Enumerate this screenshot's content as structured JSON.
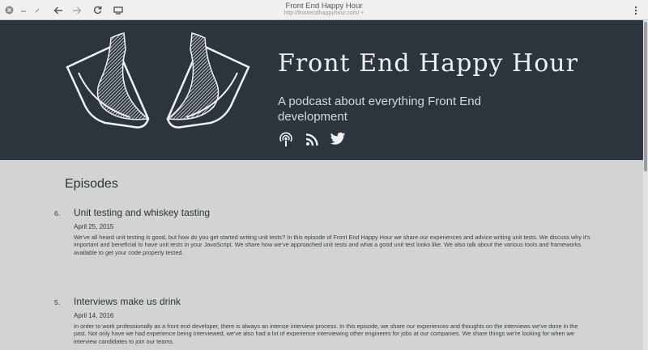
{
  "window": {
    "title": "Front End Happy Hour",
    "url": "http://frontendhappyhour.com/ +"
  },
  "toolbar": {
    "buttons": [
      "back-arrow-icon",
      "forward-arrow-icon",
      "reload-icon",
      "screen-icon"
    ]
  },
  "header": {
    "site_title": "Front End Happy Hour",
    "tagline": "A podcast about everything Front End development",
    "social_icons": [
      "podcast-icon",
      "rss-icon",
      "twitter-icon"
    ],
    "background": "#2c343e"
  },
  "content": {
    "section_title": "Episodes",
    "episodes": [
      {
        "number": "6.",
        "title": "Unit testing and whiskey tasting",
        "date": "April 25, 2015",
        "description": "We've all heard unit testing is good, but how do you get started writing unit tests? In this episode of Front End Happy Hour we share our experiences and advice writing unit tests. We discuss why it's important and beneficial to have unit tests in your JavaScript. We share how we've approached unit tests and what a good unit test looks like. We also talk about the various tools and frameworks available to get your code properly tested."
      },
      {
        "number": "5.",
        "title": "Interviews make us drink",
        "date": "April 14, 2016",
        "description": "In order to work professionally as a front end developer, there is always an intense interview process. In this episode, we share our experiences and thoughts on the interviews we've done in the past. Not only have we had experience being interviewed, we've also had a lot of experience interviewing other engineers for jobs at our companies. We share things we're looking for when we interview candidates to join our teams."
      }
    ]
  }
}
